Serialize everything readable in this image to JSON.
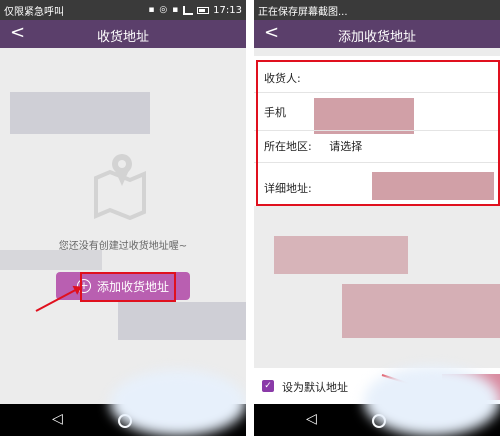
{
  "left": {
    "status_text": "仅限紧急呼叫",
    "time": "17:13",
    "header_title": "收货地址",
    "empty_message": "您还没有创建过收货地址喔~",
    "add_button_label": "添加收货地址"
  },
  "right": {
    "status_text": "正在保存屏幕截图...",
    "header_title": "添加收货地址",
    "form": {
      "recipient_label": "收货人:",
      "phone_label": "手机",
      "region_label": "所在地区:",
      "region_placeholder": "请选择",
      "detail_label": "详细地址:"
    },
    "default_address_label": "设为默认地址",
    "default_checked": true
  },
  "colors": {
    "header": "#5b3f6b",
    "accent": "#b95fb1",
    "highlight": "#e0101e"
  },
  "icons": [
    "back-icon",
    "map-pin-icon",
    "plus-circle-icon",
    "nav-back-icon",
    "nav-home-icon"
  ]
}
